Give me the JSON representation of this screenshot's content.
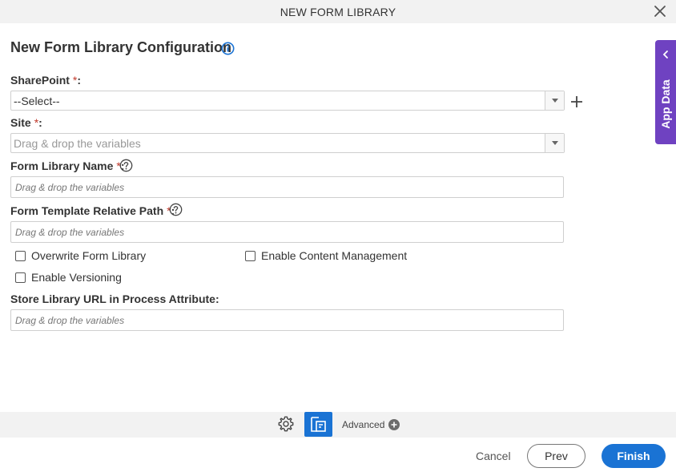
{
  "window": {
    "title": "NEW FORM LIBRARY",
    "close_icon": "close-icon"
  },
  "heading": {
    "title": "New Form Library Configuration",
    "info_icon": "info-icon"
  },
  "app_data_tab": {
    "label": "App Data",
    "icon": "chevron-left-icon",
    "color": "#6f42c1"
  },
  "fields": {
    "sharepoint": {
      "label": "SharePoint",
      "required": "*",
      "colon": ":",
      "selected": "--Select--"
    },
    "site": {
      "label": "Site",
      "required": "*",
      "colon": ":",
      "placeholder": "Drag & drop the variables"
    },
    "form_library_name": {
      "label": "Form Library Name",
      "required": "*",
      "colon": ":",
      "placeholder": "Drag & drop the variables"
    },
    "form_template_relative_path": {
      "label": "Form Template Relative Path",
      "required": "*",
      "colon": ":",
      "placeholder": "Drag & drop the variables"
    },
    "store_library_url": {
      "label": "Store Library URL in Process Attribute:",
      "placeholder": "Drag & drop the variables"
    }
  },
  "checkboxes": {
    "overwrite_form_library": {
      "label": "Overwrite Form Library",
      "checked": false
    },
    "enable_content_management": {
      "label": "Enable Content Management",
      "checked": false
    },
    "enable_versioning": {
      "label": "Enable Versioning",
      "checked": false
    }
  },
  "bottom_toolbar": {
    "advanced_label": "Advanced",
    "accent": "#1a73d4"
  },
  "footer": {
    "cancel_label": "Cancel",
    "prev_label": "Prev",
    "finish_label": "Finish"
  },
  "colors": {
    "primary": "#1a73d4",
    "required": "#c0392b",
    "bar_bg": "#f2f2f2"
  }
}
